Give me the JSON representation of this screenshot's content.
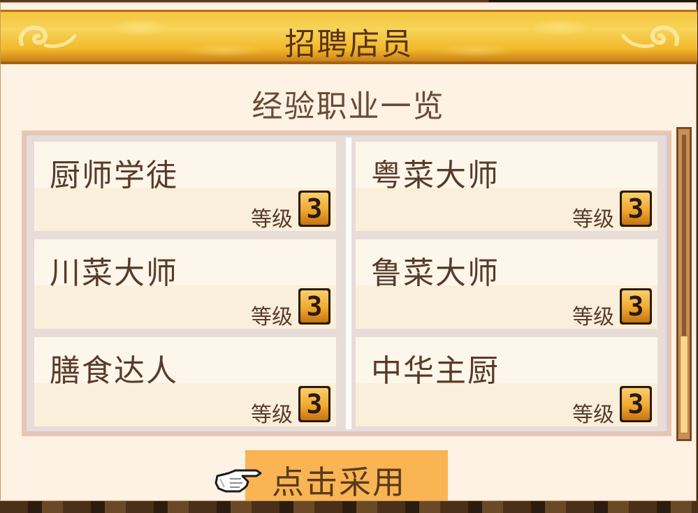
{
  "dialog": {
    "title": "招聘店员",
    "subtitle": "经验职业一览"
  },
  "jobs": [
    {
      "name": "厨师学徒",
      "level_label": "等级",
      "level": "3"
    },
    {
      "name": "粤菜大师",
      "level_label": "等级",
      "level": "3"
    },
    {
      "name": "川菜大师",
      "level_label": "等级",
      "level": "3"
    },
    {
      "name": "鲁菜大师",
      "level_label": "等级",
      "level": "3"
    },
    {
      "name": "膳食达人",
      "level_label": "等级",
      "level": "3"
    },
    {
      "name": "中华主厨",
      "level_label": "等级",
      "level": "3"
    }
  ],
  "action": {
    "adopt_label": "点击采用",
    "pointer_icon": "pointing-hand-icon"
  },
  "scroll": {
    "position": 0.73
  },
  "colors": {
    "banner_gold": "#f6c43c",
    "panel_bg": "#fdf2e4",
    "text_brown": "#5a3a2a",
    "button_orange": "#f9b454",
    "badge_gold": "#f0a830"
  }
}
